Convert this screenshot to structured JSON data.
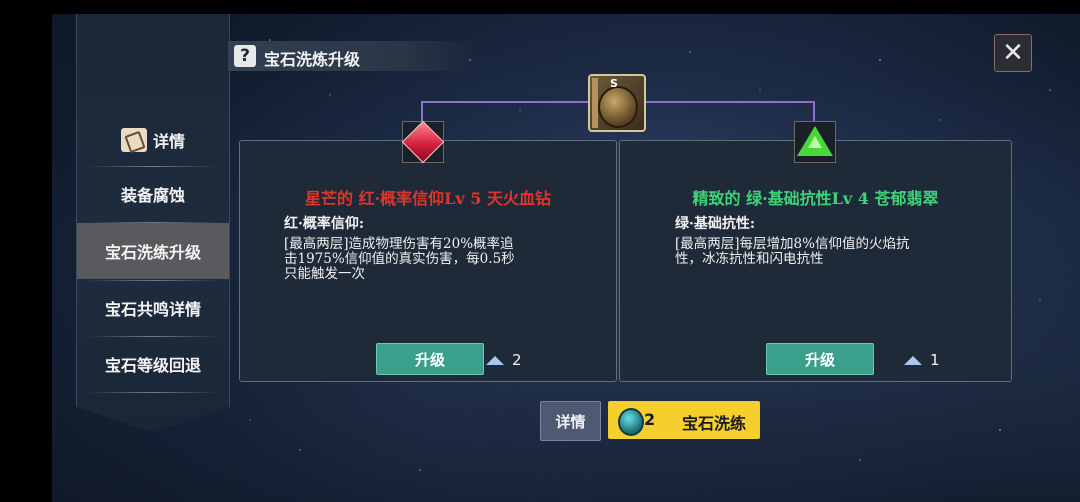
{
  "title": "宝石洗炼升级",
  "close_icon": "close-icon",
  "sidebar": {
    "detail_label": "详情",
    "items": [
      {
        "label": "装备腐蚀",
        "active": false
      },
      {
        "label": "宝石洗练升级",
        "active": true
      },
      {
        "label": "宝石共鸣详情",
        "active": false
      },
      {
        "label": "宝石等级回退",
        "active": false
      }
    ]
  },
  "top_gem": {
    "badge": "S",
    "icon": "equipment-gem-icon"
  },
  "cards": [
    {
      "name": "星芒的 红·概率信仰Lv 5 天火血钻",
      "name_color": "#e0342c",
      "subtitle": "红·概率信仰:",
      "desc_lines": [
        "[最高两层]造成物理伤害有20%概率追",
        "击1975%信仰值的真实伤害，每0.5秒",
        "只能触发一次"
      ],
      "button": "升级",
      "cost": "2",
      "gem_icon": "red-gem-icon"
    },
    {
      "name": "精致的 绿·基础抗性Lv 4 苍郁翡翠",
      "name_color": "#3fd27a",
      "subtitle": "绿·基础抗性:",
      "desc_lines": [
        "[最高两层]每层增加8%信仰值的火焰抗",
        "性，冰冻抗性和闪电抗性"
      ],
      "button": "升级",
      "cost": "1",
      "gem_icon": "green-gem-icon"
    }
  ],
  "bottom": {
    "detail_label": "详情",
    "refine_count": "2",
    "refine_label": "宝石洗练"
  }
}
